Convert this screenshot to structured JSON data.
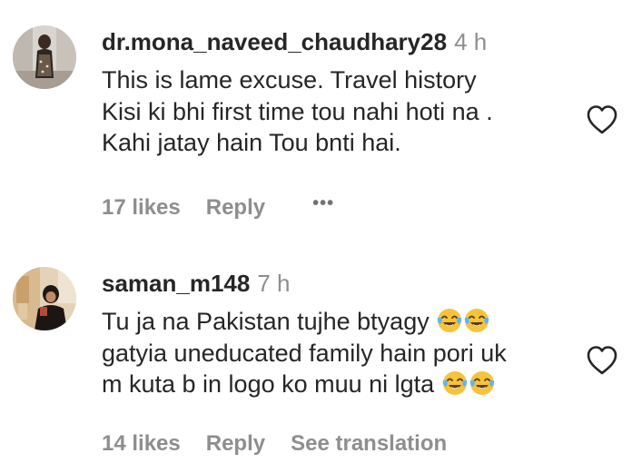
{
  "comments": [
    {
      "username": "dr.mona_naveed_chaudhary28",
      "time": "4 h",
      "lines": [
        "This is lame excuse. Travel history",
        "Kisi ki bhi first time tou nahi hoti na .",
        "Kahi jatay hain Tou bnti hai."
      ],
      "likes": "17 likes",
      "reply": "Reply",
      "more": "•••"
    },
    {
      "username": "saman_m148",
      "time": "7 h",
      "line1_text": "Tu ja na Pakistan tujhe btyagy",
      "line2_text": "gatyia uneducated family hain pori uk",
      "line3_text": "m kuta b in logo ko muu ni lgta",
      "emoji": "😂",
      "likes": "14 likes",
      "reply": "Reply",
      "see_translation": "See translation"
    }
  ],
  "icons": {
    "like": "heart-outline-icon",
    "emoji": "face-with-tears-of-joy-icon"
  },
  "colors": {
    "primary_text": "#262626",
    "secondary_text": "#8e8e8e",
    "heart_stroke": "#262626",
    "emoji_face": "#f7c33b",
    "emoji_tears": "#5db5f2"
  }
}
